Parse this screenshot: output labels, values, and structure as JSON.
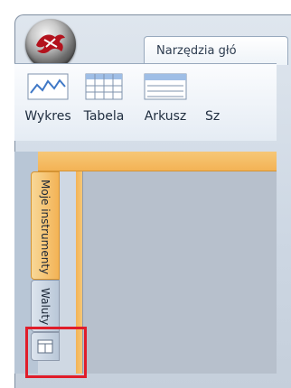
{
  "app": {
    "orb_icon": "app-logo-icon"
  },
  "tabs": {
    "main_tab_label": "Narzędzia głó"
  },
  "ribbon": {
    "buttons": [
      {
        "label": "Wykres",
        "icon": "line-chart-icon"
      },
      {
        "label": "Tabela",
        "icon": "table-icon"
      },
      {
        "label": "Arkusz",
        "icon": "sheet-icon"
      },
      {
        "label": "Sz",
        "icon": "more-icon"
      }
    ]
  },
  "side_tabs": {
    "instruments_label": "Moje instrumenty",
    "currencies_label": "Waluty",
    "layout_icon": "layout-icon"
  },
  "colors": {
    "accent_orange": "#f3b355",
    "highlight_red": "#e01d2a",
    "workspace_bg": "#b7c0cc"
  }
}
